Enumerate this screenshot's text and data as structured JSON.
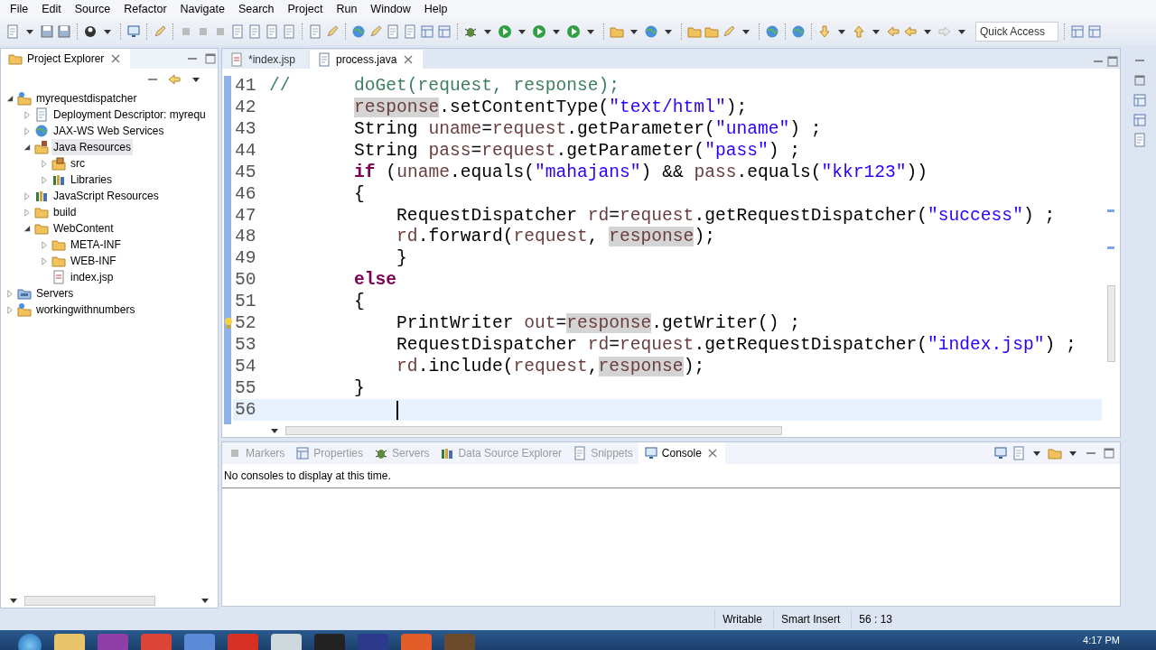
{
  "menu": [
    "File",
    "Edit",
    "Source",
    "Refactor",
    "Navigate",
    "Search",
    "Project",
    "Run",
    "Window",
    "Help"
  ],
  "quick_access": {
    "placeholder": "Quick Access"
  },
  "project_explorer": {
    "title": "Project Explorer",
    "items": [
      {
        "label": "myrequestdispatcher",
        "kind": "project",
        "expanded": true,
        "selected": false,
        "children": [
          {
            "label": "Deployment Descriptor: myrequ",
            "kind": "descriptor",
            "expanded": false,
            "selected": false
          },
          {
            "label": "JAX-WS Web Services",
            "kind": "webservice",
            "expanded": false,
            "selected": false
          },
          {
            "label": "Java Resources",
            "kind": "library",
            "expanded": true,
            "selected": true,
            "children": [
              {
                "label": "src",
                "kind": "package",
                "expanded": false,
                "selected": false
              },
              {
                "label": "Libraries",
                "kind": "books",
                "expanded": false,
                "selected": false
              }
            ]
          },
          {
            "label": "JavaScript Resources",
            "kind": "books",
            "expanded": false,
            "selected": false
          },
          {
            "label": "build",
            "kind": "folder",
            "expanded": false,
            "selected": false
          },
          {
            "label": "WebContent",
            "kind": "folder",
            "expanded": true,
            "selected": false,
            "children": [
              {
                "label": "META-INF",
                "kind": "folder",
                "expanded": false,
                "selected": false
              },
              {
                "label": "WEB-INF",
                "kind": "folder",
                "expanded": false,
                "selected": false
              },
              {
                "label": "index.jsp",
                "kind": "file",
                "selected": false
              }
            ]
          }
        ]
      },
      {
        "label": "Servers",
        "kind": "servers",
        "expanded": false,
        "selected": false
      },
      {
        "label": "workingwithnumbers",
        "kind": "project",
        "expanded": false,
        "selected": false
      }
    ]
  },
  "editor_tabs": [
    {
      "label": "*index.jsp",
      "selected": false
    },
    {
      "label": "process.java",
      "selected": true
    }
  ],
  "code_lines": [
    {
      "number": "41",
      "current": false,
      "warning": false,
      "tokens": [
        {
          "kind": "comment",
          "text": "//      doGet(request, response);"
        }
      ],
      "children": [
        {
          "number": "42",
          "current": false,
          "warning": false,
          "tokens": [
            {
              "kind": "occurrence",
              "text": "response"
            },
            {
              "kind": "plain",
              "text": ".setContentType("
            },
            {
              "kind": "string",
              "text": "\"text/html\""
            },
            {
              "kind": "plain",
              "text": ");"
            }
          ]
        },
        {
          "number": "43",
          "current": false,
          "warning": false,
          "tokens": [
            {
              "kind": "plain",
              "text": "String "
            },
            {
              "kind": "variable",
              "text": "uname"
            },
            {
              "kind": "plain",
              "text": "="
            },
            {
              "kind": "variable",
              "text": "request"
            },
            {
              "kind": "plain",
              "text": ".getParameter("
            },
            {
              "kind": "string",
              "text": "\"uname\""
            },
            {
              "kind": "plain",
              "text": ") ;"
            }
          ]
        },
        {
          "number": "44",
          "current": false,
          "warning": false,
          "tokens": [
            {
              "kind": "plain",
              "text": "String "
            },
            {
              "kind": "variable",
              "text": "pass"
            },
            {
              "kind": "plain",
              "text": "="
            },
            {
              "kind": "variable",
              "text": "request"
            },
            {
              "kind": "plain",
              "text": ".getParameter("
            },
            {
              "kind": "string",
              "text": "\"pass\""
            },
            {
              "kind": "plain",
              "text": ") ;"
            }
          ]
        },
        {
          "number": "45",
          "current": false,
          "warning": false,
          "tokens": [
            {
              "kind": "keyword",
              "text": "if"
            },
            {
              "kind": "plain",
              "text": " ("
            },
            {
              "kind": "variable",
              "text": "uname"
            },
            {
              "kind": "plain",
              "text": ".equals("
            },
            {
              "kind": "string",
              "text": "\"mahajans\""
            },
            {
              "kind": "plain",
              "text": ") && "
            },
            {
              "kind": "variable",
              "text": "pass"
            },
            {
              "kind": "plain",
              "text": ".equals("
            },
            {
              "kind": "string",
              "text": "\"kkr123\""
            },
            {
              "kind": "plain",
              "text": "))"
            }
          ]
        },
        {
          "number": "46",
          "current": false,
          "warning": false,
          "tokens": [
            {
              "kind": "plain",
              "text": "{"
            }
          ],
          "children": [
            {
              "number": "47",
              "current": false,
              "warning": false,
              "tokens": [
                {
                  "kind": "plain",
                  "text": "RequestDispatcher "
                },
                {
                  "kind": "variable",
                  "text": "rd"
                },
                {
                  "kind": "plain",
                  "text": "="
                },
                {
                  "kind": "variable",
                  "text": "request"
                },
                {
                  "kind": "plain",
                  "text": ".getRequestDispatcher("
                },
                {
                  "kind": "string",
                  "text": "\"success\""
                },
                {
                  "kind": "plain",
                  "text": ") ;"
                }
              ]
            },
            {
              "number": "48",
              "current": false,
              "warning": false,
              "tokens": [
                {
                  "kind": "variable",
                  "text": "rd"
                },
                {
                  "kind": "plain",
                  "text": ".forward("
                },
                {
                  "kind": "variable",
                  "text": "request"
                },
                {
                  "kind": "plain",
                  "text": ", "
                },
                {
                  "kind": "occurrence",
                  "text": "response"
                },
                {
                  "kind": "plain",
                  "text": ");"
                }
              ]
            },
            {
              "number": "49",
              "current": false,
              "warning": false,
              "tokens": [
                {
                  "kind": "plain",
                  "text": "}"
                }
              ]
            }
          ]
        },
        {
          "number": "50",
          "current": false,
          "warning": false,
          "tokens": [
            {
              "kind": "keyword",
              "text": "else"
            }
          ]
        },
        {
          "number": "51",
          "current": false,
          "warning": false,
          "tokens": [
            {
              "kind": "plain",
              "text": "{"
            }
          ],
          "children": [
            {
              "number": "52",
              "current": false,
              "warning": true,
              "tokens": [
                {
                  "kind": "plain",
                  "text": "PrintWriter "
                },
                {
                  "kind": "variable",
                  "text": "out"
                },
                {
                  "kind": "plain",
                  "text": "="
                },
                {
                  "kind": "occurrence",
                  "text": "response"
                },
                {
                  "kind": "plain",
                  "text": ".getWriter() ;"
                }
              ]
            },
            {
              "number": "53",
              "current": false,
              "warning": false,
              "tokens": [
                {
                  "kind": "plain",
                  "text": "RequestDispatcher "
                },
                {
                  "kind": "variable",
                  "text": "rd"
                },
                {
                  "kind": "plain",
                  "text": "="
                },
                {
                  "kind": "variable",
                  "text": "request"
                },
                {
                  "kind": "plain",
                  "text": ".getRequestDispatcher("
                },
                {
                  "kind": "string",
                  "text": "\"index.jsp\""
                },
                {
                  "kind": "plain",
                  "text": ") ;"
                }
              ]
            },
            {
              "number": "54",
              "current": false,
              "warning": false,
              "tokens": [
                {
                  "kind": "variable",
                  "text": "rd"
                },
                {
                  "kind": "plain",
                  "text": ".include("
                },
                {
                  "kind": "variable",
                  "text": "request"
                },
                {
                  "kind": "plain",
                  "text": ","
                },
                {
                  "kind": "occurrence",
                  "text": "response"
                },
                {
                  "kind": "plain",
                  "text": ");"
                }
              ]
            }
          ]
        },
        {
          "number": "55",
          "current": false,
          "warning": false,
          "tokens": [
            {
              "kind": "plain",
              "text": "}"
            }
          ],
          "children": [
            {
              "number": "56",
              "current": true,
              "warning": false
            }
          ]
        }
      ]
    }
  ],
  "bottom_tabs": [
    {
      "label": "Markers",
      "selected": false
    },
    {
      "label": "Properties",
      "selected": false
    },
    {
      "label": "Servers",
      "selected": false
    },
    {
      "label": "Data Source Explorer",
      "selected": false
    },
    {
      "label": "Snippets",
      "selected": false
    },
    {
      "label": "Console",
      "selected": true
    }
  ],
  "console_message": "No consoles to display at this time.",
  "status_bar": [
    "Writable",
    "Smart Insert",
    "56 : 13"
  ],
  "taskbar": {
    "clock": "4:17 PM"
  }
}
